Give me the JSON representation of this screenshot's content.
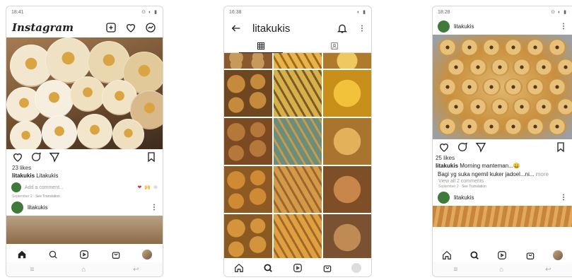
{
  "phone1": {
    "status_time": "18:41",
    "app_title": "Instagram",
    "likes": "23 likes",
    "caption_user": "litakukis",
    "caption_text": "Litakukis",
    "comment_placeholder": "Add a comment...",
    "reactions": [
      "❤",
      "🙌",
      "⊕"
    ],
    "meta_date": "September 2",
    "meta_translate": "See Translation",
    "next_post_user": "litakukis"
  },
  "phone2": {
    "status_time": "16:38",
    "profile_name": "litakukis"
  },
  "phone3": {
    "status_time": "18:28",
    "post_user": "litakukis",
    "likes": "25 likes",
    "caption_user": "litakukis",
    "caption_text": "Morning manteman...😀",
    "caption_line2": "Bagi yg suka ngemil kuker jadoel...ni...",
    "caption_more": "more",
    "view_comments": "View all 2 comments",
    "meta_date": "September 2",
    "meta_translate": "See Translation",
    "next_post_user": "litakukis"
  },
  "colors": {
    "text": "#222222",
    "muted": "#999999",
    "like_red": "#e0245e",
    "cookie_gold": "#d9a441",
    "avatar_green": "#3f7a3a"
  }
}
